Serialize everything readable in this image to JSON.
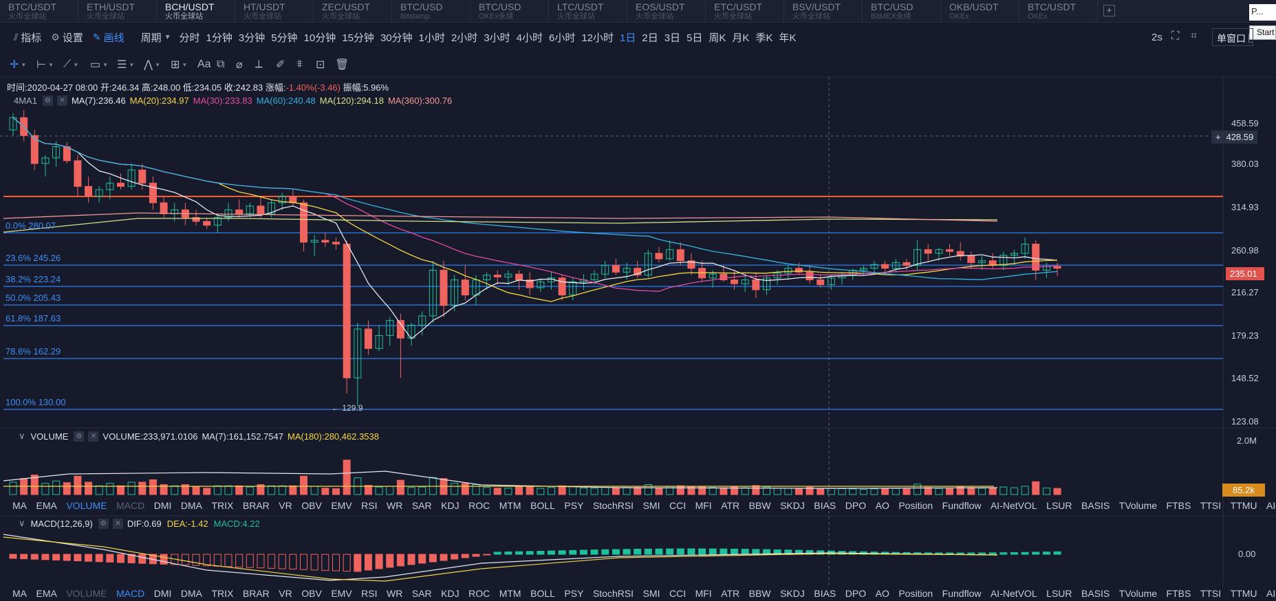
{
  "tabs": [
    {
      "pair": "BTC/USDT",
      "exchange": "火币全球站"
    },
    {
      "pair": "ETH/USDT",
      "exchange": "火币全球站"
    },
    {
      "pair": "BCH/USDT",
      "exchange": "火币全球站"
    },
    {
      "pair": "HT/USDT",
      "exchange": "火币全球站"
    },
    {
      "pair": "ZEC/USDT",
      "exchange": "火币全球站"
    },
    {
      "pair": "BTC/USD",
      "exchange": "Bitstamp"
    },
    {
      "pair": "BTC/USD",
      "exchange": "OKEx永续"
    },
    {
      "pair": "LTC/USDT",
      "exchange": "火币全球站"
    },
    {
      "pair": "EOS/USDT",
      "exchange": "火币全球站"
    },
    {
      "pair": "ETC/USDT",
      "exchange": "火币全球站"
    },
    {
      "pair": "BSV/USDT",
      "exchange": "火币全球站"
    },
    {
      "pair": "BTC/USD",
      "exchange": "BitMEX永续"
    },
    {
      "pair": "OKB/USDT",
      "exchange": "OKEx"
    },
    {
      "pair": "BTC/USDT",
      "exchange": "OKEx"
    }
  ],
  "active_tab": 2,
  "add_tab_label": "+",
  "search_value": "P...",
  "start_label": "Start",
  "toolbar": {
    "indicator": "指标",
    "settings": "设置",
    "draw": "画线",
    "period": "周期",
    "periods": [
      "分时",
      "1分钟",
      "3分钟",
      "5分钟",
      "10分钟",
      "15分钟",
      "30分钟",
      "1小时",
      "2小时",
      "3小时",
      "4小时",
      "6小时",
      "12小时",
      "1日",
      "2日",
      "3日",
      "5日",
      "周K",
      "月K",
      "季K",
      "年K"
    ],
    "active_period": 13,
    "refresh": "2s",
    "single_window": "单窗口"
  },
  "draw_tools": [
    "crosshair-tool",
    "horizontal-line-tool",
    "trend-line-tool",
    "rectangle-tool",
    "parallel-channel-tool",
    "wave-tool",
    "measure-tool",
    "text-tool",
    "magnet-tool",
    "eraser-tool",
    "ruler-tool",
    "brush-tool",
    "pattern-tool",
    "lock-tool",
    "trash-tool"
  ],
  "draw_tool_text": "Aa",
  "ohlc": {
    "time": "时间:2020-04-27 08:00",
    "open": "开:246.34",
    "high": "高:248.00",
    "low": "低:234.05",
    "close": "收:242.83",
    "change_label": "涨幅:",
    "change_value": "-1.40%(-3.46)",
    "amplitude": "振幅:5.96%"
  },
  "ma_overlay_label": "4MA1",
  "ma": [
    {
      "label": "MA(7):236.46",
      "color": "#e6e9f0"
    },
    {
      "label": "MA(20):234.97",
      "color": "#f5d845"
    },
    {
      "label": "MA(30):233.83",
      "color": "#e34ca6"
    },
    {
      "label": "MA(60):240.48",
      "color": "#36b2e0"
    },
    {
      "label": "MA(120):294.18",
      "color": "#d8e08a"
    },
    {
      "label": "MA(360):300.76",
      "color": "#f49a96"
    }
  ],
  "price_axis": [
    "458.59",
    "380.03",
    "314.93",
    "260.98",
    "216.27",
    "179.23",
    "148.52",
    "123.08"
  ],
  "crosshair_price": "428.59",
  "last_price": "235.01",
  "fib_levels": [
    {
      "label": "0.0% 280.07",
      "value": 280.07
    },
    {
      "label": "23.6% 245.26",
      "value": 245.26
    },
    {
      "label": "38.2% 223.24",
      "value": 223.24
    },
    {
      "label": "50.0% 205.43",
      "value": 205.43
    },
    {
      "label": "61.8% 187.63",
      "value": 187.63
    },
    {
      "label": "78.6% 162.29",
      "value": 162.29
    },
    {
      "label": "100.0% 130.00",
      "value": 130.0
    }
  ],
  "low_marker": "129.9",
  "volume": {
    "title": "VOLUME",
    "value": "VOLUME:233,971.0106",
    "ma7": "MA(7):161,152.7547",
    "ma180": "MA(180):280,462.3538",
    "axis_top": "2.0M",
    "last_tag": "85.2k"
  },
  "macd": {
    "title": "MACD(12,26,9)",
    "dif": "DIF:0.69",
    "dea": "DEA:-1.42",
    "macd": "MACD:4.22",
    "axis_zero": "0.00"
  },
  "indicators": [
    "MA",
    "EMA",
    "VOLUME",
    "MACD",
    "DMI",
    "DMA",
    "TRIX",
    "BRAR",
    "VR",
    "OBV",
    "EMV",
    "RSI",
    "WR",
    "SAR",
    "KDJ",
    "ROC",
    "MTM",
    "BOLL",
    "PSY",
    "StochRSI",
    "SMI",
    "CCI",
    "MFI",
    "ATR",
    "BBW",
    "SKDJ",
    "BIAS",
    "DPO",
    "AO",
    "Position",
    "Fundflow",
    "AI-NetVOL",
    "LSUR",
    "BASIS",
    "TVolume",
    "FTBS",
    "TTSI",
    "TTMU",
    "AI-BSI"
  ],
  "colors": {
    "up": "#1fc09a",
    "down": "#f0645f",
    "accent": "#3e8ef7",
    "bg": "#161a2a",
    "resistance": "#ff5a2a"
  },
  "chart_data": {
    "type": "candlestick",
    "candles": [
      [
        440,
        470,
        430,
        462
      ],
      [
        462,
        475,
        420,
        430
      ],
      [
        430,
        440,
        370,
        380
      ],
      [
        380,
        395,
        360,
        390
      ],
      [
        390,
        420,
        375,
        410
      ],
      [
        410,
        418,
        380,
        385
      ],
      [
        385,
        395,
        330,
        345
      ],
      [
        345,
        360,
        320,
        330
      ],
      [
        330,
        345,
        320,
        340
      ],
      [
        340,
        360,
        325,
        350
      ],
      [
        350,
        365,
        340,
        345
      ],
      [
        345,
        380,
        340,
        370
      ],
      [
        370,
        380,
        340,
        350
      ],
      [
        350,
        360,
        310,
        320
      ],
      [
        320,
        330,
        300,
        305
      ],
      [
        305,
        320,
        295,
        310
      ],
      [
        310,
        320,
        290,
        300
      ],
      [
        300,
        310,
        290,
        295
      ],
      [
        295,
        300,
        285,
        290
      ],
      [
        290,
        305,
        280,
        300
      ],
      [
        300,
        320,
        295,
        310
      ],
      [
        310,
        325,
        300,
        305
      ],
      [
        305,
        320,
        300,
        315
      ],
      [
        315,
        330,
        300,
        305
      ],
      [
        305,
        325,
        300,
        320
      ],
      [
        320,
        335,
        310,
        330
      ],
      [
        330,
        340,
        315,
        320
      ],
      [
        320,
        325,
        260,
        270
      ],
      [
        270,
        278,
        255,
        272
      ],
      [
        272,
        280,
        265,
        270
      ],
      [
        270,
        275,
        262,
        268
      ],
      [
        268,
        272,
        140,
        150
      ],
      [
        150,
        190,
        132,
        185
      ],
      [
        185,
        192,
        165,
        170
      ],
      [
        170,
        188,
        168,
        180
      ],
      [
        180,
        195,
        172,
        192
      ],
      [
        192,
        198,
        150,
        178
      ],
      [
        178,
        190,
        172,
        188
      ],
      [
        188,
        200,
        180,
        196
      ],
      [
        196,
        250,
        190,
        240
      ],
      [
        240,
        250,
        195,
        205
      ],
      [
        205,
        235,
        200,
        230
      ],
      [
        230,
        245,
        210,
        215
      ],
      [
        215,
        235,
        205,
        230
      ],
      [
        230,
        238,
        220,
        235
      ],
      [
        235,
        240,
        225,
        233
      ],
      [
        233,
        240,
        225,
        236
      ],
      [
        236,
        240,
        220,
        230
      ],
      [
        230,
        238,
        215,
        222
      ],
      [
        222,
        232,
        218,
        228
      ],
      [
        228,
        238,
        220,
        232
      ],
      [
        232,
        235,
        210,
        215
      ],
      [
        215,
        232,
        210,
        228
      ],
      [
        228,
        236,
        220,
        230
      ],
      [
        230,
        240,
        225,
        236
      ],
      [
        236,
        250,
        232,
        245
      ],
      [
        245,
        252,
        235,
        238
      ],
      [
        238,
        248,
        230,
        242
      ],
      [
        242,
        250,
        232,
        235
      ],
      [
        235,
        262,
        232,
        258
      ],
      [
        258,
        265,
        248,
        252
      ],
      [
        252,
        272,
        250,
        262
      ],
      [
        262,
        270,
        245,
        250
      ],
      [
        250,
        258,
        235,
        242
      ],
      [
        242,
        250,
        228,
        232
      ],
      [
        232,
        240,
        222,
        236
      ],
      [
        236,
        245,
        228,
        230
      ],
      [
        230,
        240,
        220,
        226
      ],
      [
        226,
        235,
        218,
        230
      ],
      [
        230,
        238,
        212,
        220
      ],
      [
        220,
        235,
        215,
        232
      ],
      [
        232,
        240,
        225,
        237
      ],
      [
        237,
        245,
        230,
        242
      ],
      [
        242,
        248,
        235,
        238
      ],
      [
        238,
        245,
        226,
        230
      ],
      [
        230,
        235,
        222,
        225
      ],
      [
        225,
        235,
        220,
        232
      ],
      [
        232,
        238,
        225,
        235
      ],
      [
        235,
        242,
        230,
        240
      ],
      [
        240,
        245,
        235,
        242
      ],
      [
        242,
        250,
        238,
        246
      ],
      [
        246,
        250,
        238,
        242
      ],
      [
        242,
        252,
        238,
        248
      ],
      [
        248,
        252,
        240,
        245
      ],
      [
        245,
        272,
        240,
        262
      ],
      [
        262,
        268,
        250,
        258
      ],
      [
        258,
        264,
        250,
        262
      ],
      [
        262,
        268,
        255,
        260
      ],
      [
        260,
        270,
        250,
        255
      ],
      [
        255,
        260,
        242,
        248
      ],
      [
        248,
        255,
        240,
        250
      ],
      [
        250,
        258,
        242,
        245
      ],
      [
        245,
        260,
        240,
        256
      ],
      [
        256,
        262,
        245,
        258
      ],
      [
        258,
        275,
        252,
        268
      ],
      [
        268,
        272,
        230,
        240
      ],
      [
        240,
        248,
        232,
        244
      ],
      [
        244,
        248,
        234,
        242
      ]
    ]
  }
}
